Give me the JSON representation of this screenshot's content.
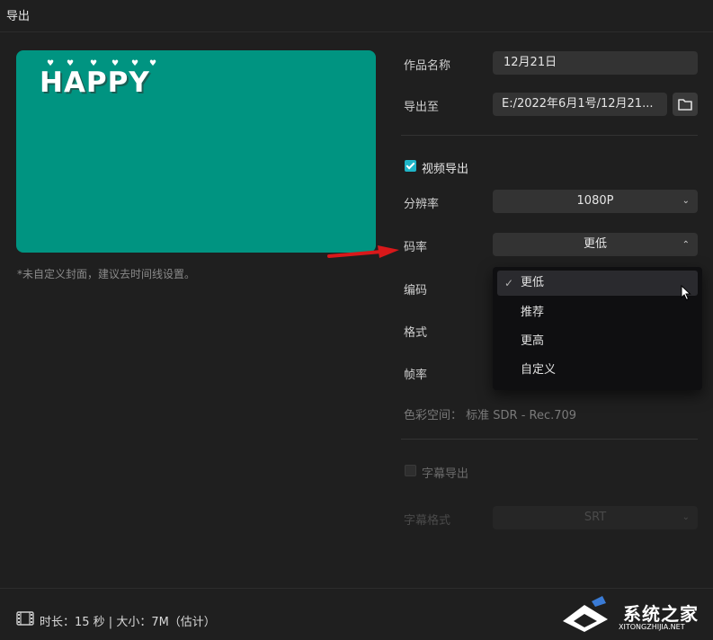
{
  "window": {
    "title": "导出"
  },
  "cover": {
    "logo_text": "HAPPY",
    "note": "*未自定义封面，建议去时间线设置。"
  },
  "form": {
    "name_label": "作品名称",
    "name_value": "12月21日",
    "export_to_label": "导出至",
    "export_to_value": "E:/2022年6月1号/12月21..."
  },
  "video_export": {
    "checkbox_label": "视频导出",
    "checked": true,
    "resolution_label": "分辨率",
    "resolution_value": "1080P",
    "bitrate_label": "码率",
    "bitrate_value": "更低",
    "codec_label": "编码",
    "format_label": "格式",
    "framerate_label": "帧率",
    "color_space": "色彩空间：  标准 SDR - Rec.709"
  },
  "bitrate_dropdown": {
    "options": [
      "更低",
      "推荐",
      "更高",
      "自定义"
    ],
    "selected": "更低",
    "selected_mark": "✓"
  },
  "subtitle_export": {
    "checkbox_label": "字幕导出",
    "checked": false,
    "format_label": "字幕格式",
    "format_value": "SRT"
  },
  "footer": {
    "info": "时长：15 秒 | 大小：7M（估计）"
  },
  "watermark": {
    "main": "系统之家",
    "sub": "XITONGZHIJIA.NET"
  },
  "icons": {
    "folder": "folder-icon",
    "chevron_down": "chevron-down-icon",
    "chevron_up": "chevron-up-icon",
    "film": "film-icon",
    "cursor": "mouse-cursor-icon",
    "annotation_arrow": "red-arrow-icon"
  },
  "colors": {
    "accent": "#1fb5c8",
    "cover_bg": "#009481",
    "arrow": "#d8181a"
  }
}
